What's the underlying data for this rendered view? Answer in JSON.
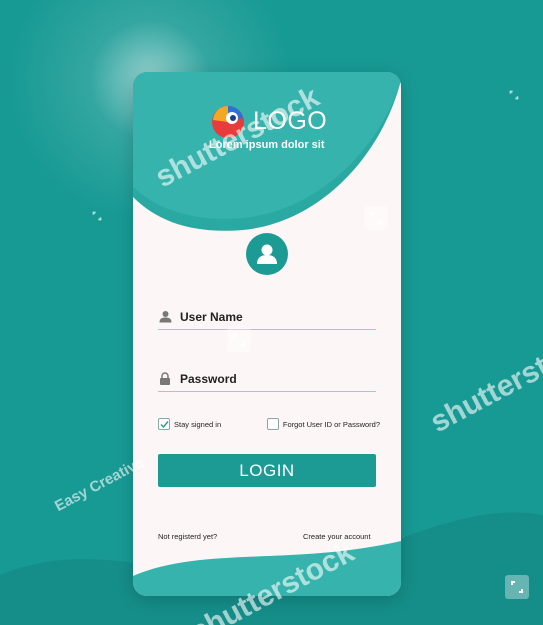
{
  "logo": {
    "text": "LOGO",
    "tagline": "Lorem ipsum dolor sit"
  },
  "form": {
    "username_placeholder": "User Name",
    "password_placeholder": "Password",
    "stay_signed_in": "Stay signed in",
    "stay_signed_in_checked": true,
    "forgot": "Forgot User ID or Password?",
    "forgot_checked": false,
    "login_label": "LOGIN"
  },
  "footer": {
    "not_registered": "Not registerd yet?",
    "create_account": "Create your account"
  },
  "watermarks": {
    "brand": "shutterstock",
    "author": "Easy Creative"
  },
  "colors": {
    "background": "#189a94",
    "accent": "#1c9b94",
    "card": "#fcf7f6",
    "underline": "#8ed3cf"
  },
  "icons": {
    "logo": "logo-mark-icon",
    "avatar": "user-avatar-icon",
    "username": "user-icon",
    "password": "lock-icon",
    "check": "checkmark-icon"
  }
}
